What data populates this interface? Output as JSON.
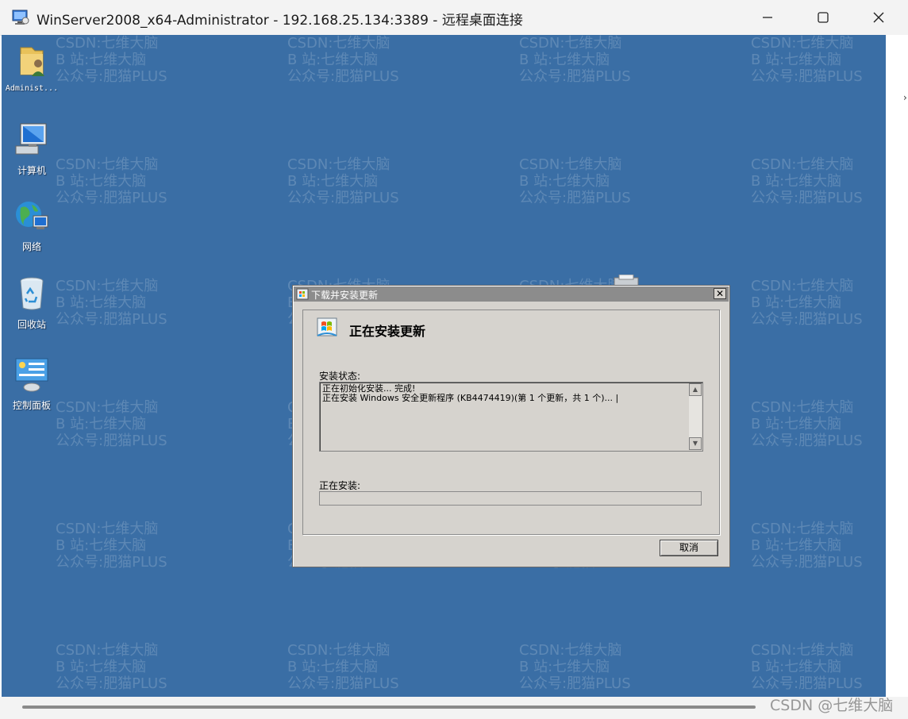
{
  "window": {
    "title": "WinServer2008_x64-Administrator - 192.168.25.134:3389 - 远程桌面连接"
  },
  "watermark": {
    "line1": "CSDN:七维大脑",
    "line2": "B 站:七维大脑",
    "line3": "公众号:肥猫PLUS"
  },
  "desktop_icons": [
    {
      "label": "Administ...",
      "icon": "user-folder-icon"
    },
    {
      "label": "计算机",
      "icon": "computer-icon"
    },
    {
      "label": "网络",
      "icon": "network-icon"
    },
    {
      "label": "回收站",
      "icon": "recycle-bin-icon"
    },
    {
      "label": "控制面板",
      "icon": "control-panel-icon"
    }
  ],
  "dialog": {
    "title": "下载并安装更新",
    "heading": "正在安装更新",
    "status_label": "安装状态:",
    "log_lines": [
      "正在初始化安装... 完成!",
      "正在安装 Windows 安全更新程序 (KB4474419)(第 1 个更新，共 1 个)... |"
    ],
    "installing_label": "正在安装:",
    "progress": 0,
    "cancel_label": "取消",
    "close_glyph": "✕"
  },
  "footer": {
    "csdn_watermark": "CSDN @七维大脑"
  },
  "colors": {
    "desktop": "#3a6ea5",
    "dialog_bg": "#d6d3ce",
    "dialog_titlebar": "#8c8c8c"
  }
}
